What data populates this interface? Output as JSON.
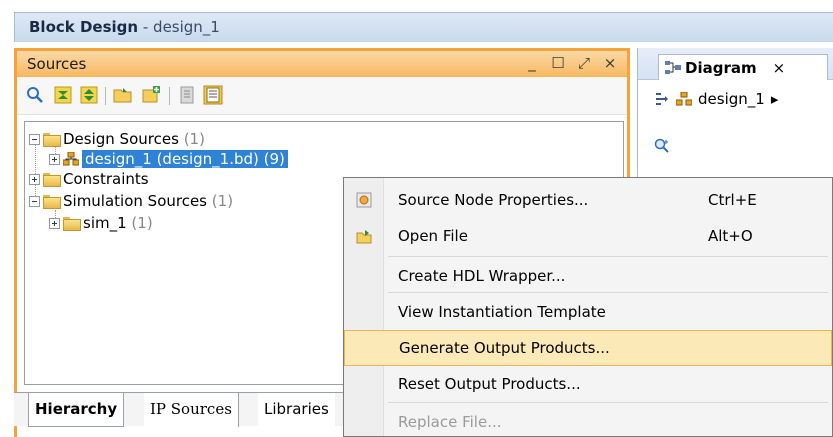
{
  "window": {
    "title_bold": "Block Design",
    "title_rest": " - design_1"
  },
  "sources_panel": {
    "title": "Sources",
    "controls": [
      "_",
      "☐",
      "⤢",
      "×"
    ],
    "tree": [
      {
        "label": "Design Sources",
        "count": "(1)"
      },
      {
        "label": "design_1 (design_1.bd) (9)"
      },
      {
        "label": "Constraints"
      },
      {
        "label": "Simulation Sources",
        "count": "(1)"
      },
      {
        "label": "sim_1",
        "count": "(1)"
      }
    ],
    "bottom_tabs": [
      "Hierarchy",
      "IP Sources",
      "Libraries"
    ]
  },
  "diagram_panel": {
    "tab_label": "Diagram",
    "tab_close": "×",
    "breadcrumb": "design_1"
  },
  "context_menu": {
    "items": [
      {
        "label": "Source Node Properties...",
        "shortcut": "Ctrl+E",
        "icon": "properties-icon"
      },
      {
        "label": "Open File",
        "shortcut": "Alt+O",
        "icon": "open-file-icon"
      },
      {
        "label": "Create HDL Wrapper..."
      },
      {
        "label": "View Instantiation Template"
      },
      {
        "label": "Generate Output Products...",
        "highlighted": true
      },
      {
        "label": "Reset Output Products..."
      },
      {
        "label": "Replace File...",
        "disabled": true
      }
    ]
  },
  "colors": {
    "active_panel_border": "#f7a33a",
    "selection": "#2f83d6",
    "menu_highlight": "#fbe9b7"
  }
}
